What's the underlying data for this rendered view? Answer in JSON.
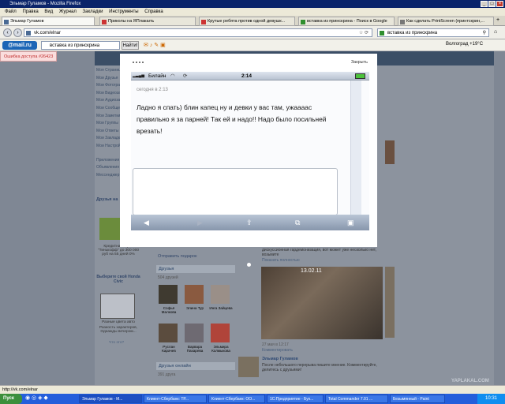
{
  "window": {
    "title": "Эльмар Гуламов - Mozilla Firefox"
  },
  "menu": [
    "Файл",
    "Правка",
    "Вид",
    "Журнал",
    "Закладки",
    "Инструменты",
    "Справка"
  ],
  "tabs": [
    {
      "label": "Эльмар Гуламов"
    },
    {
      "label": "Приколы на ЯПлакалъ"
    },
    {
      "label": "Крутые ребята против одной девушк..."
    },
    {
      "label": "вставка из принскрина - Поиск в Google"
    },
    {
      "label": "Как сделать PrintScreen (принтскрин,..."
    }
  ],
  "nav": {
    "url": "vk.com/elnar",
    "search_value": "вставка из принскрина"
  },
  "mailru": {
    "logo": "@mail.ru",
    "search_value": "вставка из принскрина",
    "find_label": "Найти!",
    "weather": "Волгоград +19°C"
  },
  "error_popup": "Ошибка доступа #26423",
  "vk": {
    "menu": [
      "Моя Страница",
      "Мои Друзья",
      "Мои Фотографии",
      "Мои Видеозаписи",
      "Мои Аудиозаписи",
      "Мои Сообщения",
      "Мои Заметки",
      "Мои Группы",
      "Мои Ответы",
      "Мои Закладки",
      "Мои Настройки"
    ],
    "menu_extra": [
      "Приложения",
      "Объявления",
      "Мессенджер"
    ],
    "left_block_title": "Друзья на",
    "ad1_title": "Кредитная карта \"Тинькофф\" до 300 000 руб на 55 дней 0%",
    "ad2_title": "Выберите свой Honda Civic",
    "ad2_caption": "Разные цвета авто",
    "ad3_text": "Разность характеров, Однажды вечером...",
    "ads_more": "Что это?",
    "gift_link": "Отправить подарок",
    "friends_title": "Друзья",
    "friends_count": "504 друзей",
    "friends": [
      {
        "name": "Софья Малкова"
      },
      {
        "name": "Элина Тур"
      },
      {
        "name": "Инга Зайцева"
      },
      {
        "name": "Руслан Карачев"
      },
      {
        "name": "Варвара Пахарева"
      },
      {
        "name": "Эльмира Колмыкова"
      }
    ],
    "online_title": "Друзья онлайн",
    "online_count": "391 друга",
    "post1_text": "дискуссионная гардемонизация, вот может уже несколько нет, возьмите",
    "post1_meta": "Показать полностью",
    "post2_date": "27 мая в 12:17",
    "post2_link": "Комментировать",
    "photo_timestamp": "13.02.11",
    "post3_author": "Эльмар Гуламов",
    "post3_text": "После небольшого перерыва пишите мнение. Комментируйте, делитесь с друзьями!"
  },
  "modal": {
    "close_label": "Закрыть",
    "carrier": "Билайн",
    "time": "2:14",
    "msg_time": "сегодня в 2:13",
    "msg_text": "Ладно я спать) блин капец ну и девки у вас там, ужаааас правильно я за парней! Так ей и надо!! Надо было посильней врезать!"
  },
  "status_bar": "http://vk.com/elnar",
  "taskbar": {
    "start": "Пуск",
    "tasks": [
      "Эльмар Гуламов - M...",
      "Клиент-Сбербанк: ТР...",
      "Клиент-Сбербанк: ОО...",
      "1С:Предприятие - Бух...",
      "Total Commander 7.01 ...",
      "Безымянный - Paint"
    ],
    "clock": "10:31"
  },
  "watermark": "YAPLAKAL.COM"
}
